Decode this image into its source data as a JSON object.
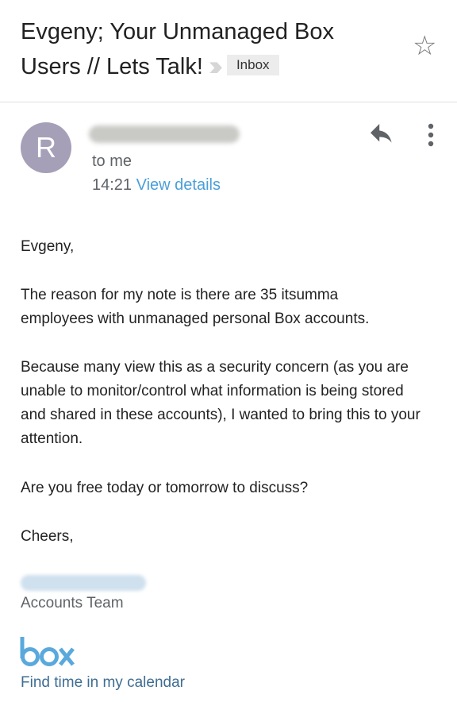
{
  "header": {
    "subject": "Evgeny; Your Unmanaged Box Users // Lets Talk!",
    "label": "Inbox"
  },
  "message": {
    "avatar_letter": "R",
    "recipient": "to me",
    "time": "14:21",
    "view_details": "View details"
  },
  "body": {
    "paragraphs": [
      "Evgeny,",
      "The reason for my note is there are 35 itsumma employees with unmanaged personal Box accounts.",
      "Because many view this as a security concern (as you are unable to monitor/control what information is being stored and shared in these accounts), I wanted to bring this to your attention.",
      "Are you free today or tomorrow to discuss?",
      "Cheers,"
    ]
  },
  "signature": {
    "team": "Accounts Team",
    "logo_text": "box",
    "calendar_link": "Find time in my calendar"
  },
  "colors": {
    "accent": "#4a9fd8",
    "avatar": "#a69fb8",
    "logo": "#5aa9dd"
  }
}
